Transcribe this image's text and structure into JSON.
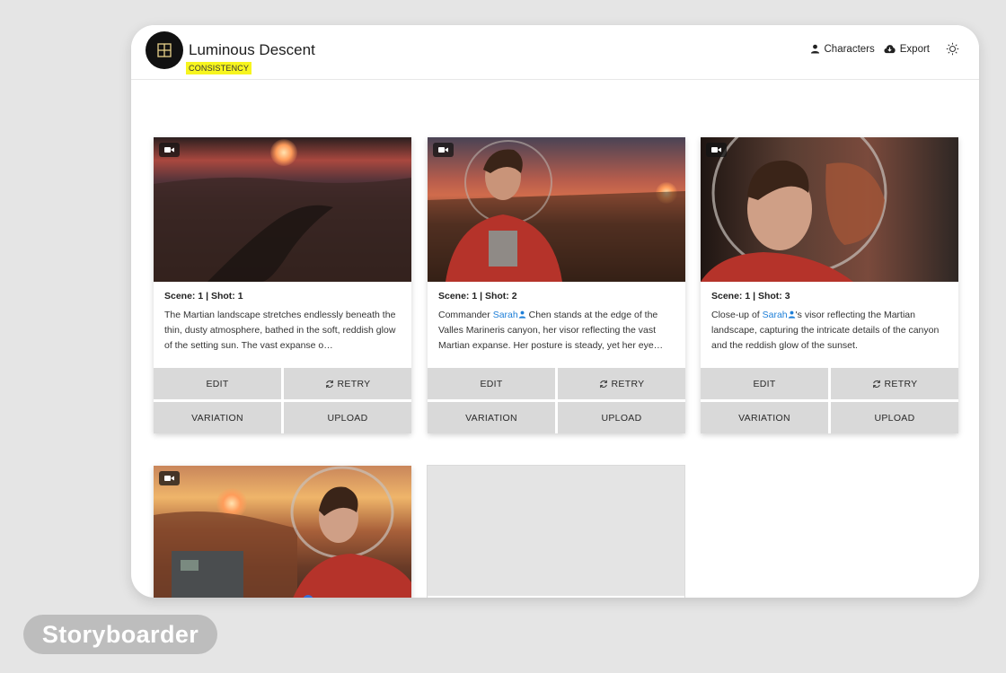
{
  "app": {
    "title": "Luminous Descent",
    "mode_badge": "CONSISTENCY",
    "logo_icon": "grid-icon"
  },
  "header": {
    "characters_label": "Characters",
    "export_label": "Export",
    "theme_icon": "sun-icon"
  },
  "colors": {
    "badge_yellow": "#f7f51f",
    "character_link": "#1e7fd8",
    "button_gray": "#d9d9d9"
  },
  "cards": [
    {
      "shot_label": "Scene: 1 | Shot: 1",
      "desc_pre": "The Martian landscape stretches endlessly beneath the thin, dusty atmosphere, bathed in the soft, reddish glow of the setting sun. The vast expanse o…",
      "character": "",
      "desc_post": "",
      "edit_label": "EDIT",
      "retry_label": "RETRY",
      "variation_label": "VARIATION",
      "upload_label": "UPLOAD"
    },
    {
      "shot_label": "Scene: 1 | Shot: 2",
      "desc_pre": "Commander ",
      "character": "Sarah",
      "desc_post": " Chen stands at the edge of the Valles Marineris canyon, her visor reflecting the vast Martian expanse. Her posture is steady, yet her eye…",
      "edit_label": "EDIT",
      "retry_label": "RETRY",
      "variation_label": "VARIATION",
      "upload_label": "UPLOAD"
    },
    {
      "shot_label": "Scene: 1 | Shot: 3",
      "desc_pre": "Close-up of ",
      "character": "Sarah",
      "desc_post": "'s visor reflecting the Martian landscape, capturing the intricate details of the canyon and the reddish glow of the sunset.",
      "edit_label": "EDIT",
      "retry_label": "RETRY",
      "variation_label": "VARIATION",
      "upload_label": "UPLOAD"
    }
  ],
  "footer": {
    "brand": "Storyboarder"
  }
}
